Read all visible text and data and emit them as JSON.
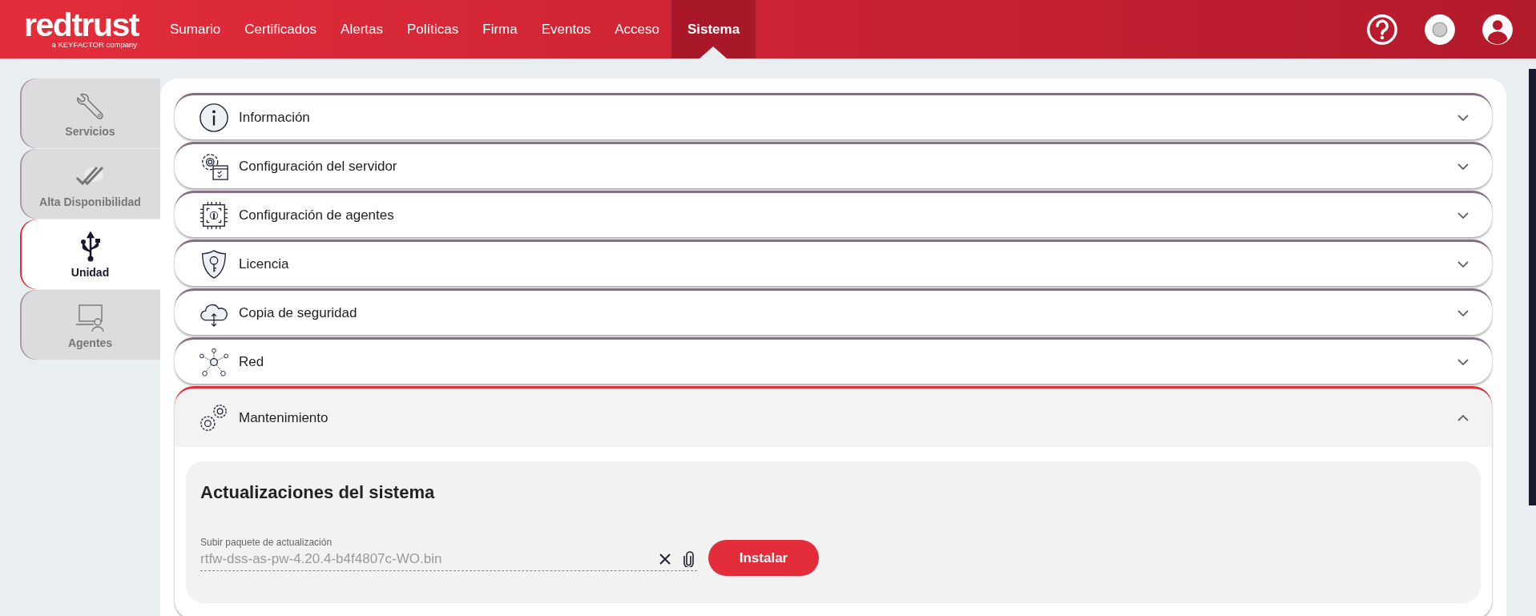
{
  "header": {
    "logo": "redtrust",
    "logo_tagline": "a KEYFACTOR company",
    "nav": [
      {
        "label": "Sumario",
        "selected": false
      },
      {
        "label": "Certificados",
        "selected": false
      },
      {
        "label": "Alertas",
        "selected": false
      },
      {
        "label": "Políticas",
        "selected": false
      },
      {
        "label": "Firma",
        "selected": false
      },
      {
        "label": "Eventos",
        "selected": false
      },
      {
        "label": "Acceso",
        "selected": false
      },
      {
        "label": "Sistema",
        "selected": true
      }
    ]
  },
  "sidebar": {
    "items": [
      {
        "label": "Servicios",
        "kind": "wrench",
        "selected": false
      },
      {
        "label": "Alta Disponibilidad",
        "kind": "checks",
        "selected": false
      },
      {
        "label": "Unidad",
        "kind": "usb",
        "selected": true
      },
      {
        "label": "Agentes",
        "kind": "agent",
        "selected": false
      }
    ]
  },
  "sections": [
    {
      "title": "Información",
      "kind": "info",
      "expanded": false
    },
    {
      "title": "Configuración del servidor",
      "kind": "server",
      "expanded": false
    },
    {
      "title": "Configuración de agentes",
      "kind": "chip",
      "expanded": false
    },
    {
      "title": "Licencia",
      "kind": "shield",
      "expanded": false
    },
    {
      "title": "Copia de seguridad",
      "kind": "cloud",
      "expanded": false
    },
    {
      "title": "Red",
      "kind": "network",
      "expanded": false
    },
    {
      "title": "Mantenimiento",
      "kind": "gears",
      "expanded": true,
      "panel": {
        "title": "Actualizaciones del sistema",
        "field_label": "Subir paquete de actualización",
        "field_value": "rtfw-dss-as-pw-4.20.4-b4f4807c-WO.bin",
        "button": "Instalar"
      }
    }
  ]
}
